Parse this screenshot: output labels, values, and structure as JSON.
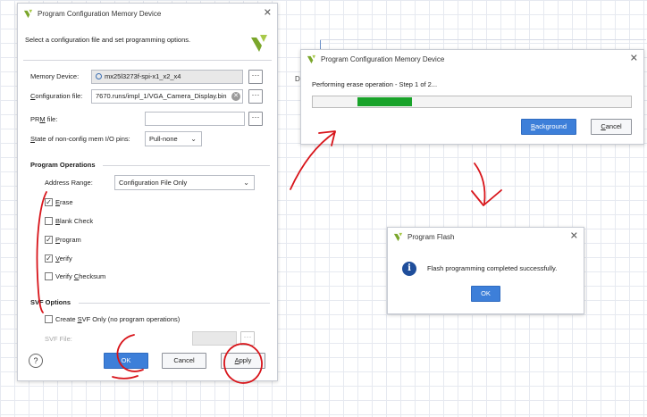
{
  "main_dialog": {
    "title": "Program Configuration Memory Device",
    "instruction": "Select a configuration file and set programming options.",
    "memory_device_label": "Memory Device:",
    "memory_device_value": "mx25l3273f-spi-x1_x2_x4",
    "config_file_label": "Configuration file:",
    "config_file_value": "7670.runs/impl_1/VGA_Camera_Display.bin",
    "prm_file_label": "PRM file:",
    "prm_file_value": "",
    "state_label": "State of non-config mem I/O pins:",
    "state_value": "Pull-none",
    "program_ops_header": "Program Operations",
    "address_range_label": "Address Range:",
    "address_range_value": "Configuration File Only",
    "ops": [
      {
        "label": "Erase",
        "checked": true
      },
      {
        "label": "Blank Check",
        "checked": false
      },
      {
        "label": "Program",
        "checked": true
      },
      {
        "label": "Verify",
        "checked": true
      },
      {
        "label": "Verify Checksum",
        "checked": false
      }
    ],
    "svf_header": "SVF Options",
    "svf_create_label": "Create SVF Only (no program operations)",
    "svf_file_label": "SVF File:",
    "help_glyph": "?",
    "browse_glyph": "···",
    "ok_label": "OK",
    "cancel_label": "Cancel",
    "apply_label": "Apply"
  },
  "progress_dialog": {
    "title": "Program Configuration Memory Device",
    "status": "Performing erase operation - Step 1 of 2...",
    "progress_percent": 17,
    "background_label": "Background",
    "cancel_label": "Cancel"
  },
  "flash_dialog": {
    "title": "Program Flash",
    "message": "Flash programming completed successfully.",
    "ok_label": "OK",
    "info_glyph": "i"
  },
  "glyphs": {
    "close": "✕",
    "check": "✓",
    "chevron": "⌄"
  },
  "colors": {
    "accent": "#3d7fd9",
    "progress": "#19a32a",
    "annotation": "#d8141a",
    "info": "#1f4e9b"
  },
  "icons": [
    "vivado-logo-icon",
    "close-icon",
    "chevron-down-icon",
    "info-icon",
    "help-icon",
    "clear-icon",
    "chip-icon"
  ]
}
